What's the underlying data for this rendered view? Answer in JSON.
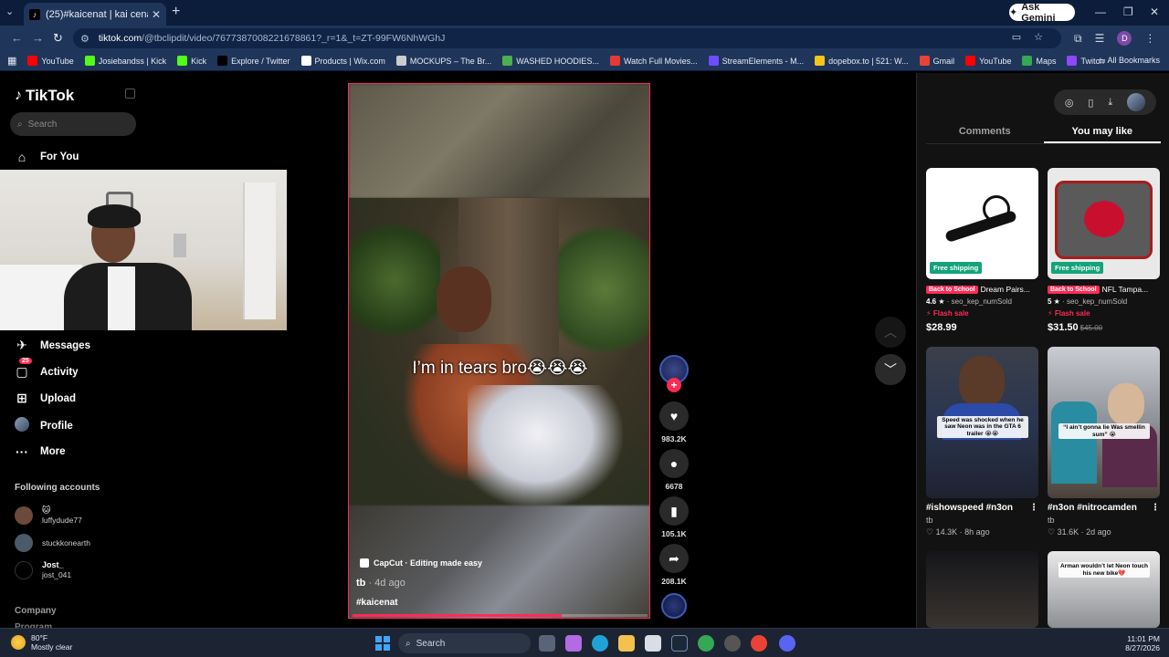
{
  "browser": {
    "tab_title": "(25)#kaicenat | kai cenat perfo",
    "url_domain": "tiktok.com",
    "url_path": "/@tbclipdit/video/7677387008221678861?_r=1&_t=ZT-99FW6NhWGhJ",
    "gemini_label": "Ask Gemini",
    "profile_initial": "D",
    "bookmarks": [
      {
        "label": "YouTube",
        "color": "#ff0000"
      },
      {
        "label": "Josiebandss | Kick",
        "color": "#53fc18"
      },
      {
        "label": "Kick",
        "color": "#53fc18"
      },
      {
        "label": "Explore / Twitter",
        "color": "#000000"
      },
      {
        "label": "Products | Wix.com",
        "color": "#ffffff"
      },
      {
        "label": "MOCKUPS – The Br...",
        "color": "#cccccc"
      },
      {
        "label": "WASHED HOODIES...",
        "color": "#4caf50"
      },
      {
        "label": "Watch Full Movies...",
        "color": "#e53935"
      },
      {
        "label": "StreamElements - M...",
        "color": "#6c4dff"
      },
      {
        "label": "dopebox.to | 521: W...",
        "color": "#f5c518"
      },
      {
        "label": "Gmail",
        "color": "#ea4335"
      },
      {
        "label": "YouTube",
        "color": "#ff0000"
      },
      {
        "label": "Maps",
        "color": "#34a853"
      },
      {
        "label": "Twitch",
        "color": "#9146ff"
      }
    ],
    "all_bookmarks": "All Bookmarks"
  },
  "sidebar": {
    "logo": "TikTok",
    "search_placeholder": "Search",
    "nav": {
      "for_you": "For You",
      "messages": "Messages",
      "activity": "Activity",
      "activity_badge": "25",
      "upload": "Upload",
      "profile": "Profile",
      "more": "More"
    },
    "following_title": "Following accounts",
    "following": [
      {
        "name": "🐱",
        "handle": "luffydude77",
        "color": "#6b4a3a"
      },
      {
        "name": "",
        "handle": "stuckkonearth",
        "color": "#4a5a6a"
      },
      {
        "name": "Jost_",
        "handle": "jost_041",
        "color": "#000000"
      }
    ],
    "company": "Company",
    "program": "Program"
  },
  "video": {
    "caption": "I’m in tears bro😭😭😭",
    "capcut": "CapCut · Editing made easy",
    "author": "tb",
    "time": " · 4d ago",
    "hashtag": "#kaicenat",
    "progress": 0.71
  },
  "actions": {
    "likes": "983.2K",
    "comments": "6678",
    "saves": "105.1K",
    "shares": "208.1K"
  },
  "right_panel": {
    "tabs": {
      "comments": "Comments",
      "you_may_like": "You may like"
    },
    "products": [
      {
        "shipping": "Free shipping",
        "tag": "Back to School",
        "title": "Dream Pairs...",
        "rating": "4.6 ★",
        "sold": "· seo_kep_numSold",
        "flash": "⚡ Flash sale",
        "price": "$28.99",
        "old_price": ""
      },
      {
        "shipping": "Free shipping",
        "tag": "Back to School",
        "title": "NFL Tampa...",
        "rating": "5 ★",
        "sold": "· seo_kep_numSold",
        "flash": "⚡ Flash sale",
        "price": "$31.50",
        "old_price": "$45.00"
      }
    ],
    "videos": [
      {
        "title": "#ishowspeed #n3on",
        "author": "tb",
        "meta": "♡ 14.3K · 8h ago",
        "thumb_caption": "Speed was shocked when he saw Neon was in the GTA 6 trailer 😭😭"
      },
      {
        "title": "#n3on #nitrocamden",
        "author": "tb",
        "meta": "♡ 31.6K · 2d ago",
        "thumb_caption": "“I ain’t gonna lie Was smellin sum” 😭"
      }
    ],
    "bottom_caption": "Arman wouldn’t let Neon touch his new bike💔"
  },
  "taskbar": {
    "temp": "80°F",
    "condition": "Mostly clear",
    "search": "Search",
    "time": "11:01 PM",
    "date": "8/27/2026"
  }
}
